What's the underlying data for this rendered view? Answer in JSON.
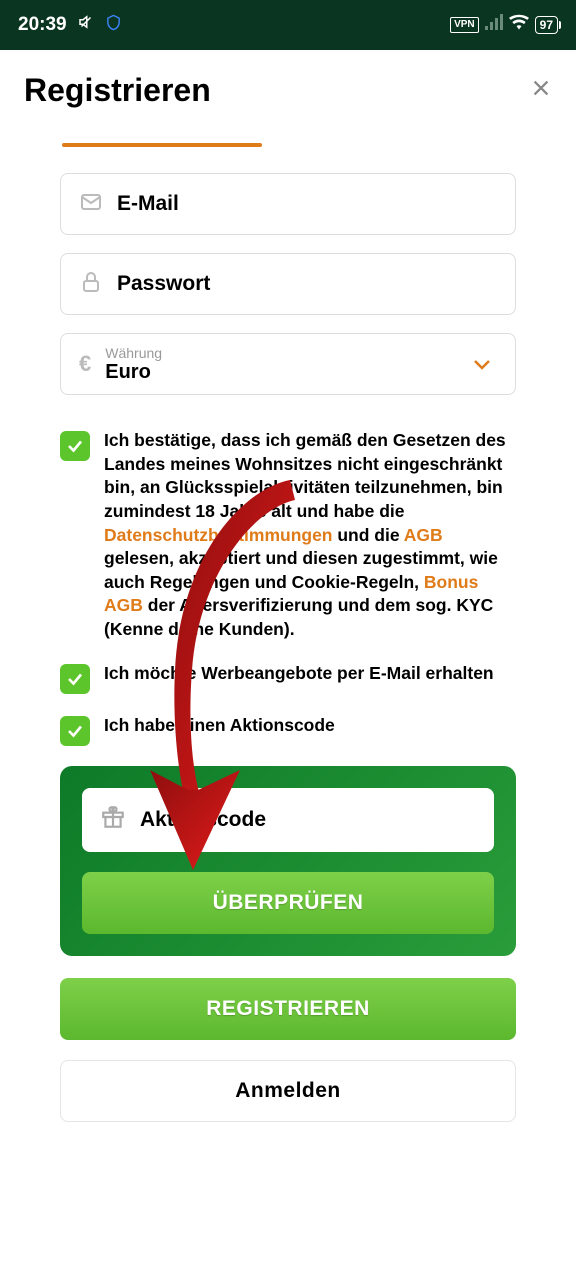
{
  "status": {
    "time": "20:39",
    "battery": "97"
  },
  "header": {
    "title": "Registrieren"
  },
  "fields": {
    "email_label": "E-Mail",
    "password_label": "Passwort",
    "currency_caption": "Währung",
    "currency_value": "Euro"
  },
  "consents": {
    "terms_p1": "Ich bestätige, dass ich gemäß den Gesetzen des Landes meines Wohnsitzes nicht eingeschränkt bin, an Glücksspielaktivitäten teilzunehmen, bin zumindest 18 Jahre alt und habe die ",
    "terms_link1": "Datenschutzbestimmungen",
    "terms_p2": " und die ",
    "terms_link2": "AGB",
    "terms_p3": " gelesen, akzeptiert und diesen zugestimmt, wie auch Regelungen und Cookie-Regeln, ",
    "terms_link3": "Bonus AGB",
    "terms_p4": " der Altersverifizierung und dem sog. KYC (Kenne deine Kunden).",
    "promo_optin": "Ich möchte Werbeangebote per E-Mail erhalten",
    "has_code": "Ich habe einen Aktionscode"
  },
  "promo": {
    "input_placeholder": "Aktionscode",
    "verify_label": "ÜBERPRÜFEN"
  },
  "buttons": {
    "register": "REGISTRIEREN",
    "login": "Anmelden"
  }
}
